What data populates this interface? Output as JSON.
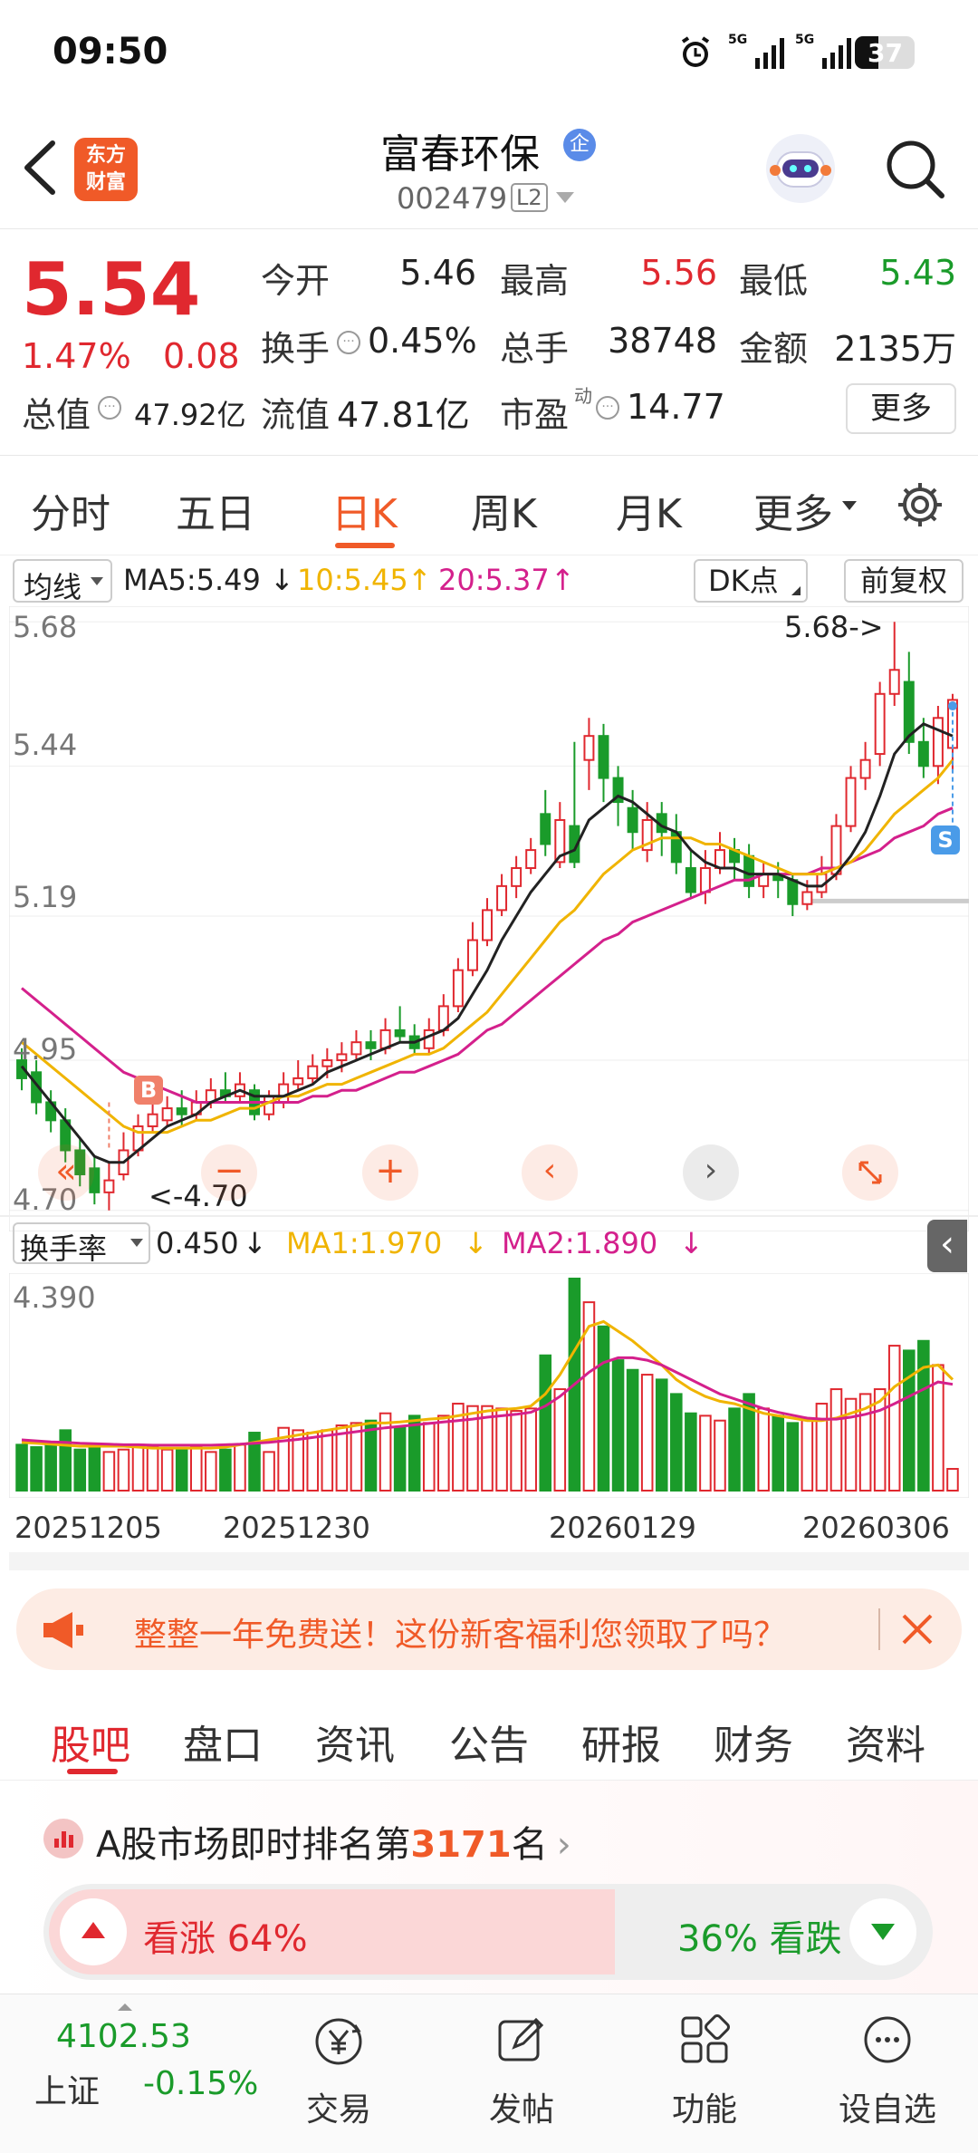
{
  "status": {
    "time": "09:50",
    "battery": "37",
    "net1": "5G",
    "net2": "5G"
  },
  "header": {
    "back_icon": "back-arrow-icon",
    "logo_line1": "东方",
    "logo_line2": "财富",
    "stock_name": "富春环保",
    "badge": "企",
    "code": "002479",
    "level": "L2"
  },
  "quote": {
    "price": "5.54",
    "pct": "1.47%",
    "change": "0.08",
    "open_label": "今开",
    "open": "5.46",
    "high_label": "最高",
    "high": "5.56",
    "low_label": "最低",
    "low": "5.43",
    "turnover_label": "换手",
    "turnover": "0.45%",
    "vol_label": "总手",
    "vol": "38748",
    "amount_label": "金额",
    "amount": "2135万",
    "mcap_label": "总值",
    "mcap": "47.92亿",
    "float_label": "流值",
    "float": "47.81亿",
    "pe_label": "市盈",
    "pe_sup": "动",
    "pe": "14.77",
    "more": "更多"
  },
  "tabs": [
    "分时",
    "五日",
    "日K",
    "周K",
    "月K",
    "更多"
  ],
  "ma": {
    "selector": "均线",
    "ma5": "MA5:5.49",
    "ma10": "10:5.45",
    "ma20": "20:5.37",
    "dk": "DK点",
    "fq": "前复权"
  },
  "chart_data": {
    "type": "candlestick",
    "y_ticks": [
      "5.68",
      "5.44",
      "5.19",
      "4.95",
      "4.70"
    ],
    "ylim": [
      4.68,
      5.7
    ],
    "dates": [
      "20251205",
      "20251230",
      "20260129",
      "20260306"
    ],
    "max_label": "5.68->",
    "min_label": "<-4.70",
    "buy_marker": "B",
    "sell_marker": "S",
    "candles": [
      [
        4.95,
        4.92,
        4.97,
        4.9
      ],
      [
        4.93,
        4.88,
        4.95,
        4.86
      ],
      [
        4.88,
        4.85,
        4.9,
        4.83
      ],
      [
        4.85,
        4.8,
        4.87,
        4.78
      ],
      [
        4.8,
        4.76,
        4.82,
        4.74
      ],
      [
        4.77,
        4.73,
        4.79,
        4.71
      ],
      [
        4.73,
        4.75,
        4.78,
        4.7
      ],
      [
        4.76,
        4.8,
        4.83,
        4.75
      ],
      [
        4.8,
        4.84,
        4.86,
        4.79
      ],
      [
        4.84,
        4.86,
        4.88,
        4.83
      ],
      [
        4.85,
        4.87,
        4.89,
        4.84
      ],
      [
        4.87,
        4.86,
        4.9,
        4.84
      ],
      [
        4.86,
        4.88,
        4.9,
        4.85
      ],
      [
        4.88,
        4.9,
        4.92,
        4.87
      ],
      [
        4.9,
        4.89,
        4.93,
        4.88
      ],
      [
        4.89,
        4.91,
        4.93,
        4.88
      ],
      [
        4.9,
        4.86,
        4.91,
        4.85
      ],
      [
        4.86,
        4.89,
        4.9,
        4.85
      ],
      [
        4.88,
        4.91,
        4.93,
        4.87
      ],
      [
        4.91,
        4.92,
        4.95,
        4.9
      ],
      [
        4.92,
        4.94,
        4.96,
        4.91
      ],
      [
        4.94,
        4.95,
        4.97,
        4.92
      ],
      [
        4.95,
        4.96,
        4.98,
        4.93
      ],
      [
        4.96,
        4.98,
        5.0,
        4.95
      ],
      [
        4.98,
        4.97,
        5.0,
        4.95
      ],
      [
        4.97,
        5.0,
        5.02,
        4.96
      ],
      [
        5.0,
        4.99,
        5.04,
        4.98
      ],
      [
        4.99,
        4.97,
        5.01,
        4.96
      ],
      [
        4.97,
        5.0,
        5.02,
        4.96
      ],
      [
        5.0,
        5.04,
        5.06,
        4.99
      ],
      [
        5.04,
        5.1,
        5.12,
        5.03
      ],
      [
        5.1,
        5.15,
        5.18,
        5.09
      ],
      [
        5.15,
        5.2,
        5.22,
        5.14
      ],
      [
        5.2,
        5.24,
        5.26,
        5.19
      ],
      [
        5.24,
        5.27,
        5.29,
        5.22
      ],
      [
        5.27,
        5.3,
        5.32,
        5.26
      ],
      [
        5.36,
        5.31,
        5.4,
        5.29
      ],
      [
        5.28,
        5.35,
        5.38,
        5.27
      ],
      [
        5.34,
        5.28,
        5.48,
        5.27
      ],
      [
        5.45,
        5.49,
        5.52,
        5.4
      ],
      [
        5.49,
        5.42,
        5.51,
        5.38
      ],
      [
        5.42,
        5.38,
        5.44,
        5.34
      ],
      [
        5.37,
        5.33,
        5.4,
        5.3
      ],
      [
        5.3,
        5.35,
        5.38,
        5.28
      ],
      [
        5.36,
        5.33,
        5.38,
        5.29
      ],
      [
        5.33,
        5.28,
        5.36,
        5.26
      ],
      [
        5.27,
        5.23,
        5.3,
        5.22
      ],
      [
        5.23,
        5.27,
        5.3,
        5.21
      ],
      [
        5.27,
        5.3,
        5.33,
        5.26
      ],
      [
        5.3,
        5.28,
        5.32,
        5.25
      ],
      [
        5.29,
        5.24,
        5.31,
        5.22
      ],
      [
        5.24,
        5.26,
        5.28,
        5.22
      ],
      [
        5.26,
        5.25,
        5.28,
        5.22
      ],
      [
        5.25,
        5.21,
        5.26,
        5.19
      ],
      [
        5.21,
        5.23,
        5.25,
        5.2
      ],
      [
        5.23,
        5.26,
        5.29,
        5.22
      ],
      [
        5.26,
        5.34,
        5.36,
        5.25
      ],
      [
        5.34,
        5.42,
        5.44,
        5.33
      ],
      [
        5.42,
        5.45,
        5.48,
        5.4
      ],
      [
        5.46,
        5.56,
        5.58,
        5.44
      ],
      [
        5.56,
        5.6,
        5.68,
        5.54
      ],
      [
        5.58,
        5.48,
        5.63,
        5.46
      ],
      [
        5.48,
        5.44,
        5.52,
        5.42
      ],
      [
        5.44,
        5.52,
        5.54,
        5.41
      ],
      [
        5.47,
        5.55,
        5.56,
        5.43
      ]
    ],
    "ma5": [
      4.94,
      4.91,
      4.88,
      4.85,
      4.82,
      4.79,
      4.78,
      4.78,
      4.8,
      4.82,
      4.84,
      4.85,
      4.86,
      4.88,
      4.89,
      4.9,
      4.89,
      4.89,
      4.89,
      4.9,
      4.91,
      4.93,
      4.94,
      4.95,
      4.96,
      4.97,
      4.98,
      4.98,
      4.99,
      5.0,
      5.02,
      5.06,
      5.1,
      5.15,
      5.19,
      5.23,
      5.26,
      5.29,
      5.3,
      5.35,
      5.37,
      5.39,
      5.38,
      5.36,
      5.34,
      5.33,
      5.3,
      5.28,
      5.27,
      5.27,
      5.26,
      5.26,
      5.26,
      5.25,
      5.24,
      5.24,
      5.26,
      5.29,
      5.33,
      5.39,
      5.46,
      5.49,
      5.51,
      5.5,
      5.49
    ],
    "ma10": [
      4.98,
      4.96,
      4.94,
      4.92,
      4.9,
      4.88,
      4.86,
      4.84,
      4.83,
      4.83,
      4.83,
      4.84,
      4.85,
      4.85,
      4.86,
      4.87,
      4.87,
      4.88,
      4.89,
      4.89,
      4.9,
      4.91,
      4.91,
      4.92,
      4.93,
      4.94,
      4.95,
      4.96,
      4.96,
      4.97,
      4.99,
      5.01,
      5.03,
      5.06,
      5.09,
      5.12,
      5.15,
      5.18,
      5.2,
      5.23,
      5.26,
      5.28,
      5.3,
      5.31,
      5.32,
      5.32,
      5.32,
      5.31,
      5.31,
      5.3,
      5.29,
      5.28,
      5.27,
      5.26,
      5.26,
      5.26,
      5.27,
      5.28,
      5.3,
      5.33,
      5.36,
      5.38,
      5.4,
      5.42,
      5.45
    ],
    "ma20": [
      5.07,
      5.05,
      5.03,
      5.01,
      4.99,
      4.97,
      4.95,
      4.93,
      4.92,
      4.91,
      4.9,
      4.89,
      4.88,
      4.88,
      4.88,
      4.88,
      4.88,
      4.88,
      4.88,
      4.88,
      4.89,
      4.89,
      4.9,
      4.9,
      4.91,
      4.92,
      4.93,
      4.93,
      4.94,
      4.95,
      4.96,
      4.98,
      5.0,
      5.01,
      5.03,
      5.05,
      5.07,
      5.09,
      5.11,
      5.13,
      5.15,
      5.16,
      5.18,
      5.19,
      5.2,
      5.21,
      5.22,
      5.23,
      5.24,
      5.25,
      5.25,
      5.26,
      5.26,
      5.26,
      5.26,
      5.27,
      5.27,
      5.28,
      5.29,
      5.3,
      5.32,
      5.33,
      5.34,
      5.36,
      5.37
    ],
    "turnover_ylim": [
      0,
      4.39
    ],
    "turnover": [
      0.95,
      0.9,
      0.95,
      1.25,
      0.85,
      0.9,
      0.8,
      0.85,
      0.95,
      0.9,
      0.85,
      0.85,
      0.9,
      0.8,
      0.85,
      0.95,
      1.2,
      0.8,
      1.3,
      1.25,
      1.2,
      1.25,
      1.35,
      1.4,
      1.45,
      1.6,
      1.3,
      1.55,
      1.4,
      1.55,
      1.8,
      1.75,
      1.75,
      1.7,
      1.65,
      1.7,
      2.8,
      2.1,
      4.39,
      3.9,
      3.4,
      2.7,
      2.5,
      2.4,
      2.3,
      2.0,
      1.6,
      1.55,
      1.45,
      1.7,
      2.0,
      1.7,
      1.55,
      1.4,
      1.5,
      1.8,
      2.1,
      1.9,
      2.0,
      2.1,
      3.0,
      2.9,
      3.1,
      2.6,
      0.45
    ],
    "turnover_ma1": [
      1.0,
      0.98,
      0.96,
      0.94,
      0.92,
      0.92,
      0.92,
      0.92,
      0.9,
      0.88,
      0.88,
      0.88,
      0.88,
      0.88,
      0.9,
      0.95,
      1.0,
      1.05,
      1.1,
      1.15,
      1.2,
      1.25,
      1.3,
      1.35,
      1.4,
      1.4,
      1.42,
      1.45,
      1.48,
      1.5,
      1.55,
      1.6,
      1.65,
      1.68,
      1.7,
      1.75,
      2.0,
      2.4,
      2.9,
      3.4,
      3.5,
      3.3,
      3.1,
      2.85,
      2.6,
      2.3,
      2.1,
      1.95,
      1.85,
      1.8,
      1.7,
      1.6,
      1.55,
      1.5,
      1.45,
      1.45,
      1.5,
      1.6,
      1.7,
      1.85,
      2.15,
      2.35,
      2.55,
      2.6,
      2.3
    ],
    "turnover_ma2": [
      1.05,
      1.03,
      1.01,
      1.0,
      0.98,
      0.97,
      0.96,
      0.95,
      0.95,
      0.94,
      0.94,
      0.94,
      0.94,
      0.94,
      0.95,
      0.96,
      0.98,
      1.0,
      1.03,
      1.06,
      1.1,
      1.14,
      1.18,
      1.22,
      1.26,
      1.3,
      1.33,
      1.36,
      1.39,
      1.42,
      1.45,
      1.48,
      1.52,
      1.55,
      1.58,
      1.62,
      1.75,
      1.95,
      2.2,
      2.45,
      2.65,
      2.75,
      2.75,
      2.7,
      2.6,
      2.45,
      2.3,
      2.15,
      2.0,
      1.9,
      1.8,
      1.7,
      1.62,
      1.56,
      1.5,
      1.48,
      1.48,
      1.52,
      1.58,
      1.66,
      1.8,
      1.95,
      2.1,
      2.25,
      2.2
    ]
  },
  "turnover_bar": {
    "selector": "换手率",
    "value": "0.450",
    "ma1": "MA1:1.970",
    "ma2": "MA2:1.890",
    "ytick": "4.390"
  },
  "ad": {
    "text": "整整一年免费送！这份新客福利您领取了吗？"
  },
  "bottom_tabs": [
    "股吧",
    "盘口",
    "资讯",
    "公告",
    "研报",
    "财务",
    "资料"
  ],
  "rank": {
    "prefix": "A股市场即时排名第",
    "num": "3171",
    "suffix": "名",
    "up": "看涨 64%",
    "down": "36% 看跌",
    "up_pct": 64
  },
  "bottombar": {
    "index_value": "4102.53",
    "index_name": "上证",
    "index_pct": "-0.15%",
    "trade": "交易",
    "post": "发帖",
    "func": "功能",
    "watch": "设自选"
  },
  "colors": {
    "up": "#e0282f",
    "down": "#1a9b2a",
    "ma5": "#222222",
    "ma10": "#f0b400",
    "ma20": "#d4208c",
    "accent": "#f05a28"
  }
}
